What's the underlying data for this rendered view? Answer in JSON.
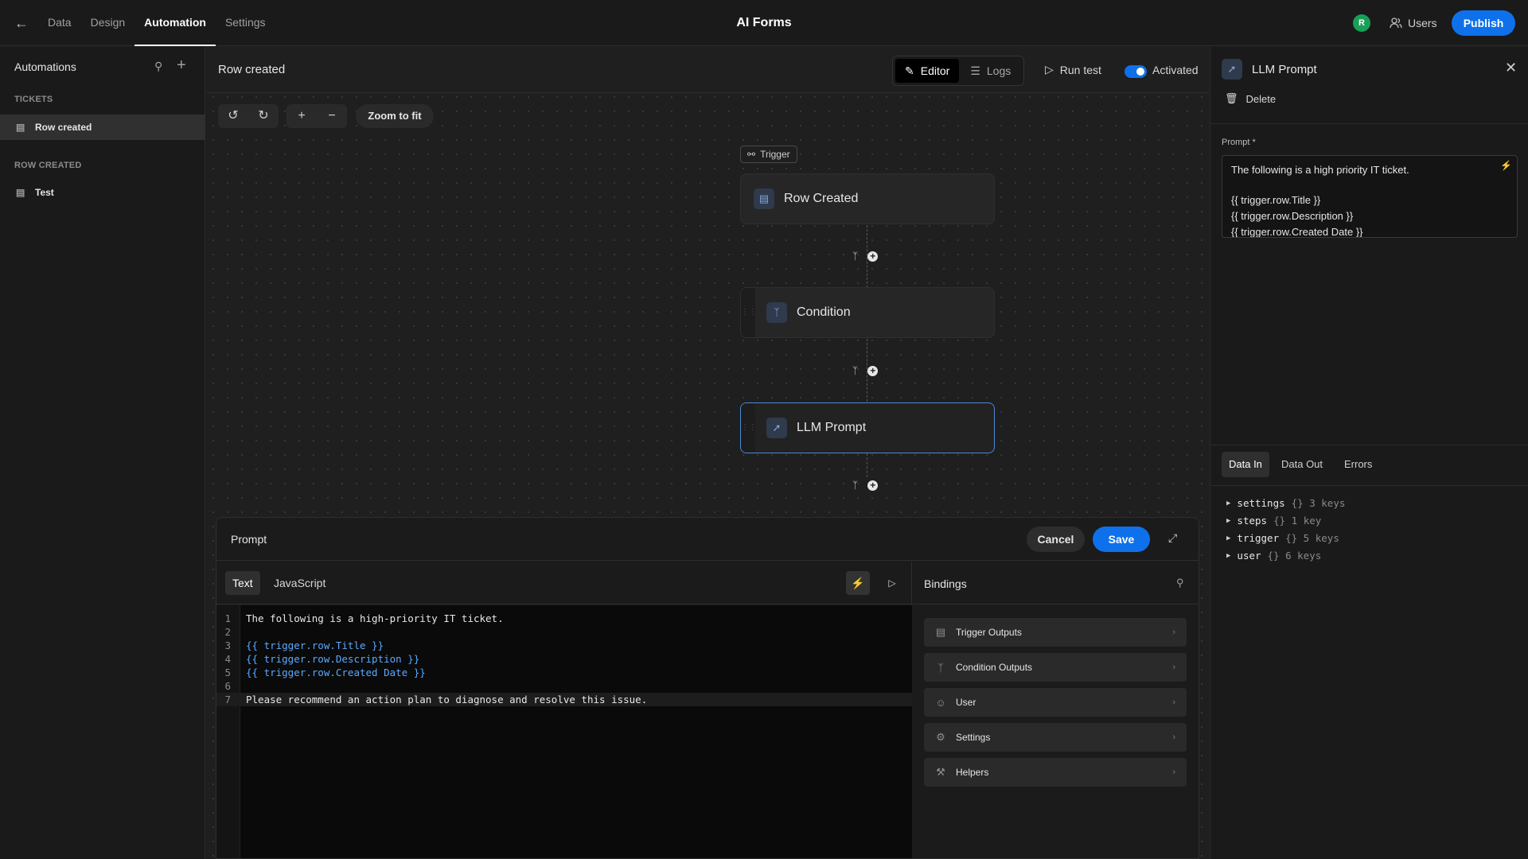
{
  "topbar": {
    "nav": [
      "Data",
      "Design",
      "Automation",
      "Settings"
    ],
    "app_title": "AI Forms",
    "avatar_initial": "R",
    "users_label": "Users",
    "publish_label": "Publish"
  },
  "sidebar": {
    "title": "Automations",
    "groups": [
      {
        "name": "TICKETS",
        "items": [
          "Row created"
        ]
      },
      {
        "name": "ROW CREATED",
        "items": [
          "Test"
        ]
      }
    ]
  },
  "header": {
    "title": "Row created",
    "editor_label": "Editor",
    "logs_label": "Logs",
    "run_test_label": "Run test",
    "activated_label": "Activated"
  },
  "canvas": {
    "zoom_fit_label": "Zoom to fit",
    "trigger_pill": "Trigger",
    "nodes": [
      "Row Created",
      "Condition",
      "LLM Prompt"
    ]
  },
  "prompt_modal": {
    "title": "Prompt",
    "cancel_label": "Cancel",
    "save_label": "Save",
    "tabs": [
      "Text",
      "JavaScript"
    ],
    "code_lines": [
      "The following is a high-priority IT ticket.",
      "",
      "{{ trigger.row.Title }}",
      "{{ trigger.row.Description }}",
      "{{ trigger.row.Created Date }}",
      "",
      "Please recommend an action plan to diagnose and resolve this issue."
    ],
    "bindings_title": "Bindings",
    "bindings": [
      "Trigger Outputs",
      "Condition Outputs",
      "User",
      "Settings",
      "Helpers"
    ]
  },
  "right_panel": {
    "title": "LLM Prompt",
    "delete_label": "Delete",
    "prompt_label": "Prompt *",
    "prompt_lines": [
      "The following is a high priority IT ticket.",
      "",
      "{{ trigger.row.Title }}",
      "{{ trigger.row.Description }}",
      "{{ trigger.row.Created Date }}"
    ],
    "data_tabs": [
      "Data In",
      "Data Out",
      "Errors"
    ],
    "data_in": [
      {
        "key": "settings",
        "meta": "{} 3 keys"
      },
      {
        "key": "steps",
        "meta": "{} 1 key"
      },
      {
        "key": "trigger",
        "meta": "{} 5 keys"
      },
      {
        "key": "user",
        "meta": "{} 6 keys"
      }
    ]
  },
  "colors": {
    "accent": "#0e71eb",
    "avatar": "#18a058",
    "binding_text": "#5aa9ff"
  }
}
